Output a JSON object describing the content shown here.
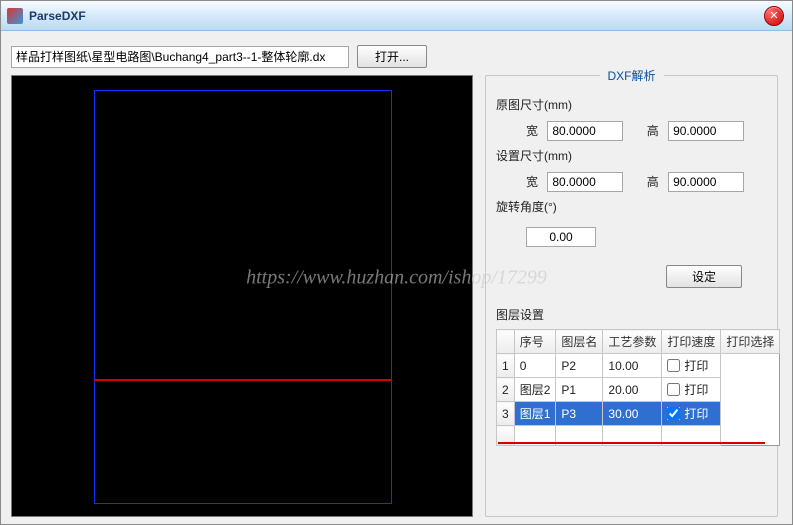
{
  "window": {
    "title": "ParseDXF"
  },
  "pathbox": {
    "value": "样品打样图纸\\星型电路图\\Buchang4_part3--1-整体轮廓.dx",
    "open_label": "打开..."
  },
  "groupbox": {
    "title": "DXF解析"
  },
  "labels": {
    "orig_size": "原图尺寸(mm)",
    "set_size": "设置尺寸(mm)",
    "width": "宽",
    "height": "高",
    "rotation": "旋转角度(°)",
    "set_button": "设定",
    "layer_settings": "图层设置"
  },
  "values": {
    "orig_w": "80.0000",
    "orig_h": "90.0000",
    "set_w": "80.0000",
    "set_h": "90.0000",
    "rot": "0.00"
  },
  "grid": {
    "headers": {
      "c1": "序号",
      "c2": "图层名",
      "c3": "工艺参数",
      "c4": "打印速度",
      "c5": "打印选择"
    },
    "rows": [
      {
        "idx": "1",
        "name": "0",
        "param": "P2",
        "speed": "10.00",
        "print": false,
        "print_label": "打印",
        "selected": false
      },
      {
        "idx": "2",
        "name": "图层2",
        "param": "P1",
        "speed": "20.00",
        "print": false,
        "print_label": "打印",
        "selected": false
      },
      {
        "idx": "3",
        "name": "图层1",
        "param": "P3",
        "speed": "30.00",
        "print": true,
        "print_label": "打印",
        "selected": true
      }
    ]
  },
  "watermark": "https://www.huzhan.com/ishop/17299"
}
